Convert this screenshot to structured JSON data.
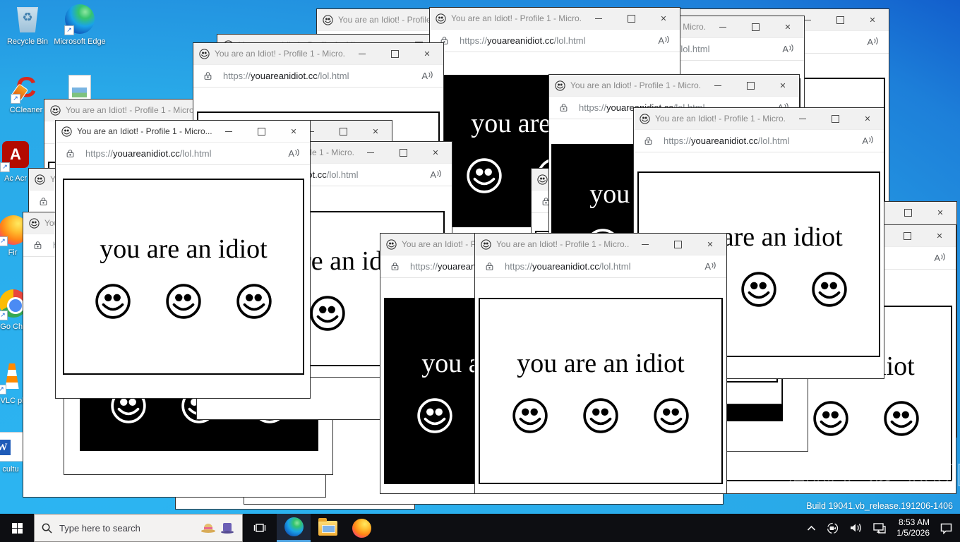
{
  "desktop": {
    "icons": [
      {
        "name": "recycle-bin",
        "label": "Recycle Bin"
      },
      {
        "name": "microsoft-edge-shortcut",
        "label": "Microsoft Edge"
      },
      {
        "name": "ccleaner-shortcut",
        "label": "CCleaner"
      },
      {
        "name": "image-file",
        "label": ""
      },
      {
        "name": "adobe-acrobat-shortcut",
        "label": "Ac Acr"
      },
      {
        "name": "firefox-shortcut",
        "label": "Fir"
      },
      {
        "name": "google-chrome-shortcut",
        "label": "Go Chr"
      },
      {
        "name": "vlc-shortcut",
        "label": "VLC pl"
      },
      {
        "name": "word-document",
        "label": "cultu"
      }
    ]
  },
  "browser": {
    "window_title": "You are an Idiot! - Profile 1 - Micro...",
    "url": {
      "scheme": "https://",
      "domain": "youareanidiot.cc",
      "path": "/lol.html"
    },
    "page_text": "you are an idiot",
    "read_aloud_label": "A",
    "colors": {
      "flash_black": "#000000",
      "flash_white": "#ffffff"
    }
  },
  "windows": [
    {
      "name": "window-1",
      "flash": "white"
    },
    {
      "name": "window-2",
      "flash": "white"
    },
    {
      "name": "window-3",
      "flash": "white"
    },
    {
      "name": "window-4",
      "flash": "white"
    },
    {
      "name": "window-5",
      "flash": "white"
    },
    {
      "name": "window-6",
      "flash": "white"
    },
    {
      "name": "window-7",
      "flash": "black"
    },
    {
      "name": "window-8",
      "flash": "black"
    },
    {
      "name": "window-9",
      "flash": "white"
    },
    {
      "name": "window-10",
      "flash": "black"
    },
    {
      "name": "window-11",
      "flash": "white"
    },
    {
      "name": "window-12",
      "flash": "white"
    },
    {
      "name": "window-13",
      "flash": "white"
    },
    {
      "name": "window-14",
      "flash": "blank"
    },
    {
      "name": "window-15",
      "flash": "blank"
    },
    {
      "name": "window-16",
      "flash": "blank"
    },
    {
      "name": "window-17",
      "flash": "black"
    },
    {
      "name": "window-18",
      "flash": "blank"
    },
    {
      "name": "window-19",
      "flash": "white"
    },
    {
      "name": "window-20",
      "flash": "white"
    },
    {
      "name": "window-21",
      "flash": "white"
    },
    {
      "name": "window-22",
      "flash": "black"
    },
    {
      "name": "window-23",
      "flash": "white"
    },
    {
      "name": "window-24",
      "flash": "white"
    }
  ],
  "taskbar": {
    "search_placeholder": "Type here to search"
  },
  "tray": {
    "time": "8:53 AM",
    "date": "1/5/2026"
  },
  "watermark": {
    "brand_left": "ANY",
    "brand_right": "RUN"
  },
  "os": {
    "build_text": "Build 19041.vb_release.191206-1406"
  }
}
